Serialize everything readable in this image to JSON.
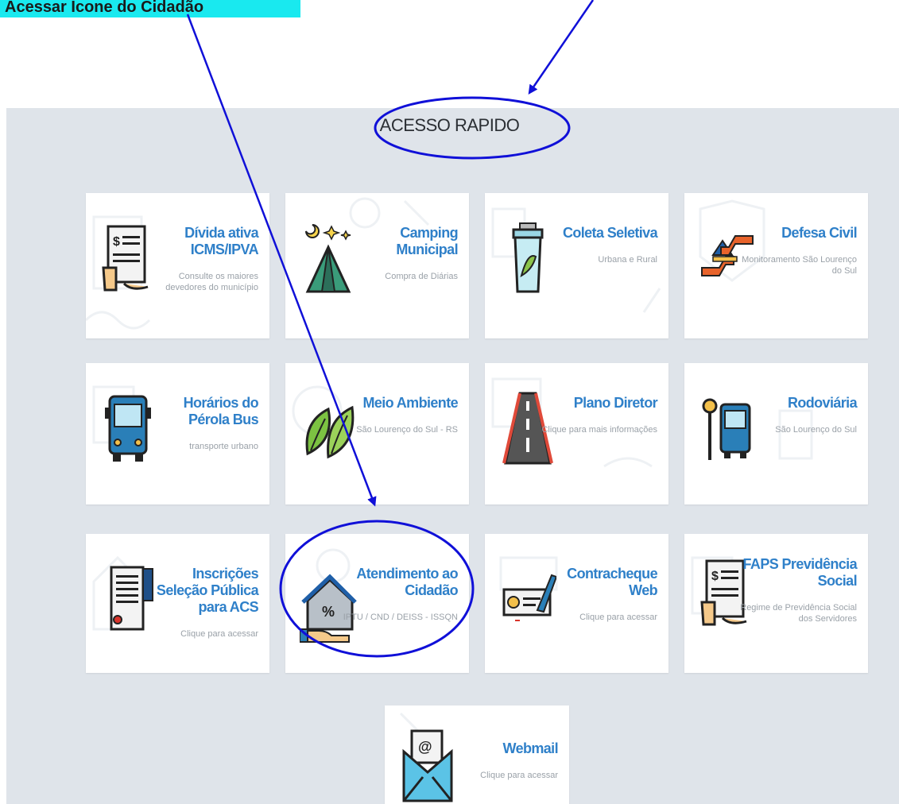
{
  "top_label": "Acessar Ícone do Cidadão",
  "section_title": "ACESSO RAPIDO",
  "cards": [
    {
      "title": "Dívida ativa ICMS/IPVA",
      "sub": "Consulte os maiores devedores do município",
      "icon": "document-hand-icon"
    },
    {
      "title": "Camping Municipal",
      "sub": "Compra de Diárias",
      "icon": "tent-icon"
    },
    {
      "title": "Coleta Seletiva",
      "sub": "Urbana e Rural",
      "icon": "recycle-bin-icon"
    },
    {
      "title": "Defesa Civil",
      "sub": "Monitoramento São Lourenço do Sul",
      "icon": "shield-hands-icon"
    },
    {
      "title": "Horários do Pérola Bus",
      "sub": "transporte urbano",
      "icon": "bus-icon"
    },
    {
      "title": "Meio Ambiente",
      "sub": "São Lourenço do Sul - RS",
      "icon": "leaves-icon"
    },
    {
      "title": "Plano Diretor",
      "sub": "Clique para mais informações",
      "icon": "road-icon"
    },
    {
      "title": "Rodoviária",
      "sub": "São Lourenço do Sul",
      "icon": "bus-stop-icon"
    },
    {
      "title": "Inscrições Seleção Pública para ACS",
      "sub": "Clique para acessar",
      "icon": "certificate-icon"
    },
    {
      "title": "Atendimento ao Cidadão",
      "sub": "IPTU / CND / DEISS - ISSQN",
      "icon": "house-tax-icon"
    },
    {
      "title": "Contracheque Web",
      "sub": "Clique para acessar",
      "icon": "check-pen-icon"
    },
    {
      "title": "FAPS Previdência Social",
      "sub": "Regime de Previdência Social dos Servidores",
      "icon": "document-hand-icon"
    },
    {
      "title": "Webmail",
      "sub": "Clique para acessar",
      "icon": "mail-icon"
    }
  ],
  "colors": {
    "accent": "#2f80c9",
    "annotation": "#1010d8",
    "panel": "#dfe4ea",
    "highlight": "#19e9ef"
  }
}
